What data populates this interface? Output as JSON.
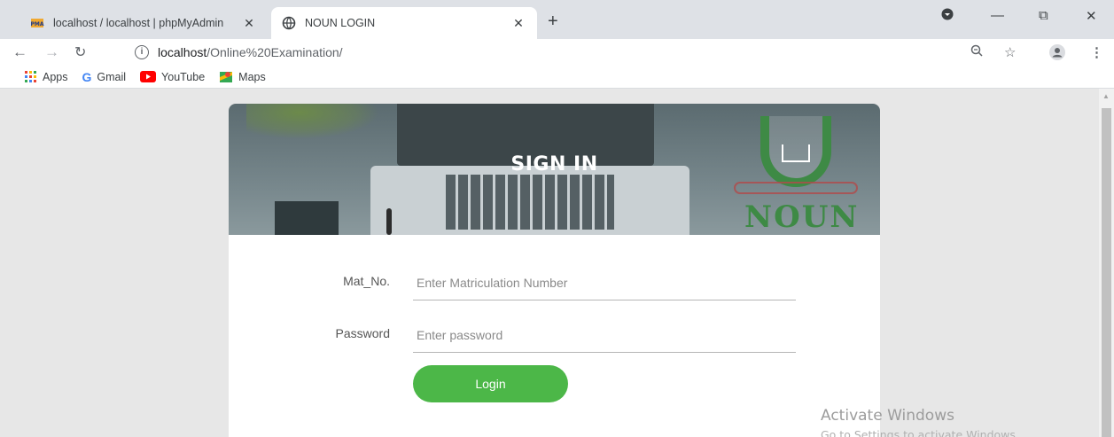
{
  "tabs": [
    {
      "title": "localhost / localhost | phpMyAdmin",
      "icon": "phpmyadmin-icon"
    },
    {
      "title": "NOUN LOGIN",
      "icon": "globe-icon"
    }
  ],
  "address": {
    "host": "localhost",
    "path": "/Online%20Examination/"
  },
  "bookmarks": [
    {
      "label": "Apps",
      "icon": "apps-grid-icon"
    },
    {
      "label": "Gmail",
      "icon": "google-g-icon"
    },
    {
      "label": "YouTube",
      "icon": "youtube-icon"
    },
    {
      "label": "Maps",
      "icon": "maps-pin-icon"
    }
  ],
  "login": {
    "heading": "SIGN IN",
    "logo_text": "NOUN",
    "mat_label": "Mat_No.",
    "mat_placeholder": "Enter Matriculation Number",
    "password_label": "Password",
    "password_placeholder": "Enter password",
    "button_label": "Login"
  },
  "watermark": {
    "line1": "Activate Windows",
    "line2": "Go to Settings to activate Windows."
  },
  "colors": {
    "accent_green": "#4cb748",
    "banner_gray": "#6f7f84",
    "logo_green": "#3e8a45"
  }
}
